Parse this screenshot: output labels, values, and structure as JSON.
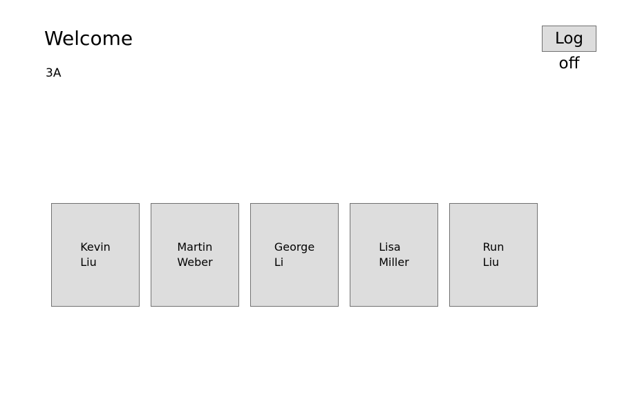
{
  "header": {
    "title": "Welcome",
    "class_name": "3A",
    "logoff_label": "Log off"
  },
  "students": [
    {
      "first": "Kevin",
      "last": "Liu"
    },
    {
      "first": "Martin",
      "last": "Weber"
    },
    {
      "first": "George",
      "last": "Li"
    },
    {
      "first": "Lisa",
      "last": "Miller"
    },
    {
      "first": "Run",
      "last": "Liu"
    }
  ],
  "colors": {
    "tile_background": "#dddddd",
    "tile_border": "#707070",
    "page_background": "#ffffff"
  }
}
